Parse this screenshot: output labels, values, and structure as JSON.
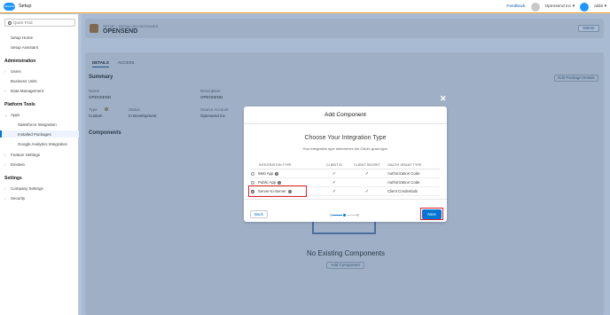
{
  "topbar": {
    "logo_text": "salesforce",
    "app_name": "Setup",
    "feedback": "Feedback",
    "org": "Opensend Inc ▾",
    "user": "aldin ▾"
  },
  "sidebar": {
    "search_placeholder": "Quick Find",
    "items": [
      "Setup Home",
      "Setup Assistant"
    ],
    "sections": {
      "administration": "Administration",
      "platform_tools": "Platform Tools",
      "settings": "Settings"
    },
    "admin_items": [
      "Users",
      "Business Units",
      "Data Management"
    ],
    "platform_items": [
      "Apps",
      "Salesforce Integration",
      "Installed Packages",
      "Google Analytics Integration",
      "Feature Settings",
      "Einstein"
    ],
    "settings_items": [
      "Company Settings",
      "Security"
    ],
    "active": "Installed Packages"
  },
  "page": {
    "breadcrumb": "SETUP > INSTALLED PACKAGES",
    "title": "OPENSEND",
    "delete_label": "Delete",
    "tabs": [
      "DETAILS",
      "ACCESS"
    ],
    "summary_title": "Summary",
    "edit_label": "Edit Package Details",
    "fields": [
      {
        "label": "Name",
        "value": "OPENSEND"
      },
      {
        "label": "Description",
        "value": "OPENSEND"
      },
      {
        "label": "Type",
        "value": "Custom"
      },
      {
        "label": "Status",
        "value": "In Development"
      },
      {
        "label": "Source Account",
        "value": "Opensend Inc"
      }
    ],
    "components_title": "Components",
    "empty_title": "No Existing Components",
    "add_component_label": "Add Component"
  },
  "modal": {
    "title": "Add Component",
    "subtitle": "Choose Your Integration Type",
    "description": "Your integration type determines the OAuth grant type.",
    "columns": [
      "INTEGRATION TYPE",
      "CLIENT ID",
      "CLIENT SECRET",
      "OAUTH GRANT TYPE"
    ],
    "rows": [
      {
        "name": "Web App",
        "client_id": "✓",
        "client_secret": "✓",
        "grant": "Authorization Code",
        "selected": false
      },
      {
        "name": "Public App",
        "client_id": "✓",
        "client_secret": "",
        "grant": "Authorization Code",
        "selected": false
      },
      {
        "name": "Server-to-Server",
        "client_id": "✓",
        "client_secret": "✓",
        "grant": "Client Credentials",
        "selected": true
      }
    ],
    "back_label": "Back",
    "next_label": "Next",
    "progress_step": 2,
    "progress_total": 3
  },
  "colors": {
    "brand": "#0176d3",
    "highlight": "#d9232e",
    "topbar_accent": "#f5a623"
  }
}
